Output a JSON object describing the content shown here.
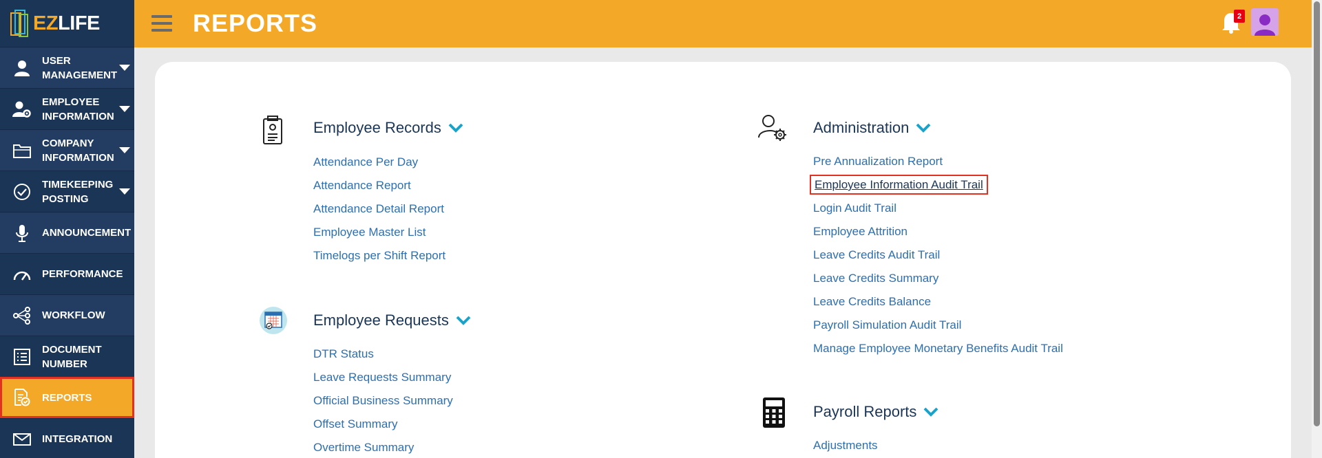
{
  "app": {
    "logo_prefix": "EZ",
    "logo_suffix": "LIFE"
  },
  "header": {
    "title": "REPORTS",
    "notification_count": "2"
  },
  "sidebar": {
    "items": [
      {
        "label": "USER MANAGEMENT",
        "icon": "user-icon",
        "has_submenu": true
      },
      {
        "label": "EMPLOYEE INFORMATION",
        "icon": "user-gear-icon",
        "has_submenu": true
      },
      {
        "label": "COMPANY INFORMATION",
        "icon": "folder-icon",
        "has_submenu": true
      },
      {
        "label": "TIMEKEEPING POSTING",
        "icon": "check-circle-icon",
        "has_submenu": true
      },
      {
        "label": "ANNOUNCEMENT",
        "icon": "microphone-icon",
        "has_submenu": false
      },
      {
        "label": "PERFORMANCE",
        "icon": "gauge-icon",
        "has_submenu": false
      },
      {
        "label": "WORKFLOW",
        "icon": "workflow-icon",
        "has_submenu": false
      },
      {
        "label": "DOCUMENT NUMBER",
        "icon": "list-icon",
        "has_submenu": false
      },
      {
        "label": "REPORTS",
        "icon": "report-icon",
        "has_submenu": false,
        "active": true
      },
      {
        "label": "INTEGRATION",
        "icon": "envelope-icon",
        "has_submenu": false
      }
    ]
  },
  "sections": {
    "employee_records": {
      "title": "Employee Records",
      "links": [
        "Attendance Per Day",
        "Attendance Report",
        "Attendance Detail Report",
        "Employee Master List",
        "Timelogs per Shift Report"
      ]
    },
    "employee_requests": {
      "title": "Employee Requests",
      "links": [
        "DTR Status",
        "Leave Requests Summary",
        "Official Business Summary",
        "Offset Summary",
        "Overtime Summary"
      ]
    },
    "administration": {
      "title": "Administration",
      "links": [
        "Pre Annualization Report",
        "Employee Information Audit Trail",
        "Login Audit Trail",
        "Employee Attrition",
        "Leave Credits Audit Trail",
        "Leave Credits Summary",
        "Leave Credits Balance",
        "Payroll Simulation Audit Trail",
        "Manage Employee Monetary Benefits Audit Trail"
      ]
    },
    "payroll_reports": {
      "title": "Payroll Reports",
      "links": [
        "Adjustments"
      ]
    }
  },
  "colors": {
    "accent": "#f4a827",
    "sidebar": "#1b3556",
    "link": "#2c6fb0",
    "chevron": "#1aa3c9",
    "highlight": "#e33121"
  }
}
